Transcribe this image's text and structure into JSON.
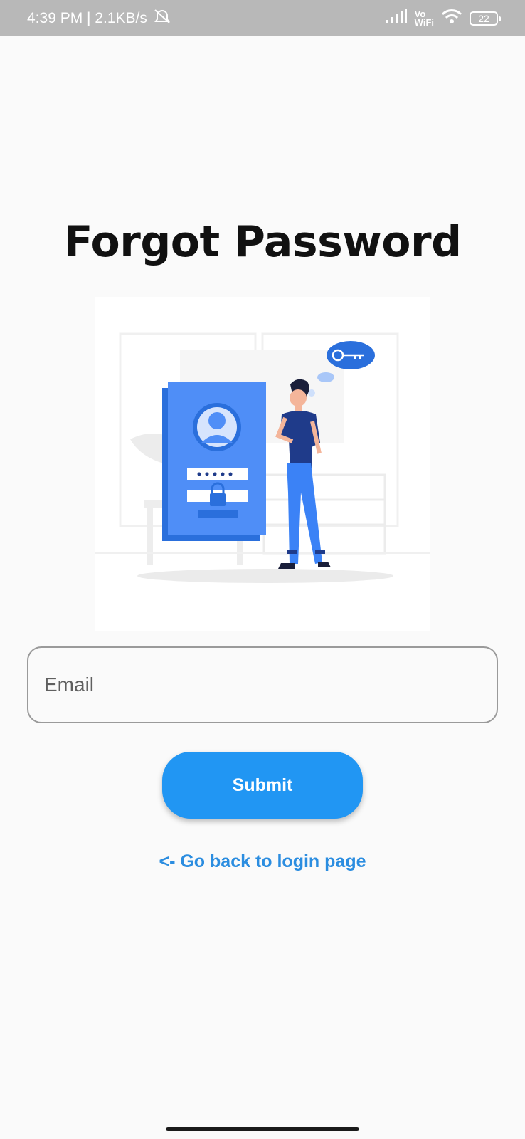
{
  "status_bar": {
    "time_speed": "4:39 PM | 2.1KB/s",
    "vo_label": "Vo",
    "wifi_label": "WiFi",
    "battery": "22"
  },
  "page": {
    "title": "Forgot Password"
  },
  "form": {
    "email_placeholder": "Email",
    "submit_label": "Submit",
    "back_link": "<- Go back to login page"
  },
  "colors": {
    "accent": "#2196f3",
    "link": "#2b8de0",
    "illustration_blue": "#4f8ef7",
    "illustration_navy": "#1f3b8a"
  }
}
